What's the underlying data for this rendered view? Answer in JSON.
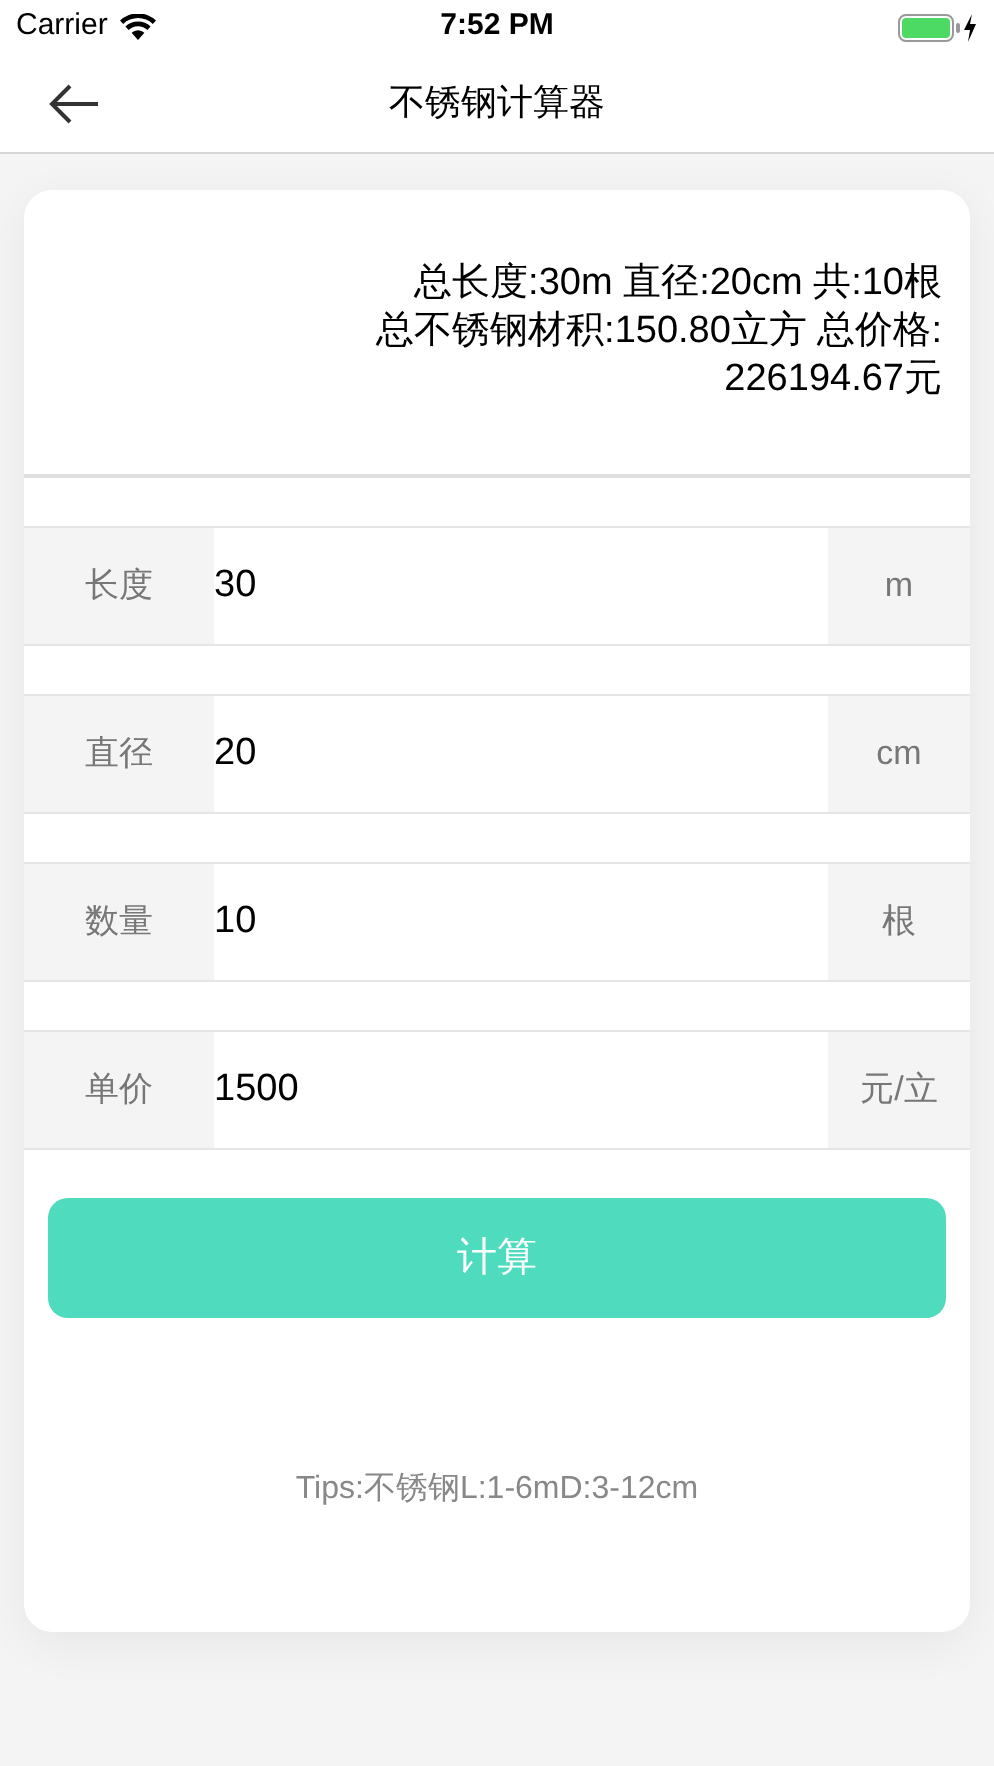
{
  "status_bar": {
    "carrier": "Carrier",
    "time": "7:52 PM"
  },
  "nav": {
    "title": "不锈钢计算器"
  },
  "result_lines": [
    "总长度:30m 直径:20cm 共:10根",
    "总不锈钢材积:150.80立方 总价格:",
    "226194.67元"
  ],
  "fields": [
    {
      "label": "长度",
      "value": "30",
      "unit": "m"
    },
    {
      "label": "直径",
      "value": "20",
      "unit": "cm"
    },
    {
      "label": "数量",
      "value": "10",
      "unit": "根"
    },
    {
      "label": "单价",
      "value": "1500",
      "unit": "元/立"
    }
  ],
  "button": "计算",
  "tips": "Tips:不锈钢L:1-6mD:3-12cm"
}
